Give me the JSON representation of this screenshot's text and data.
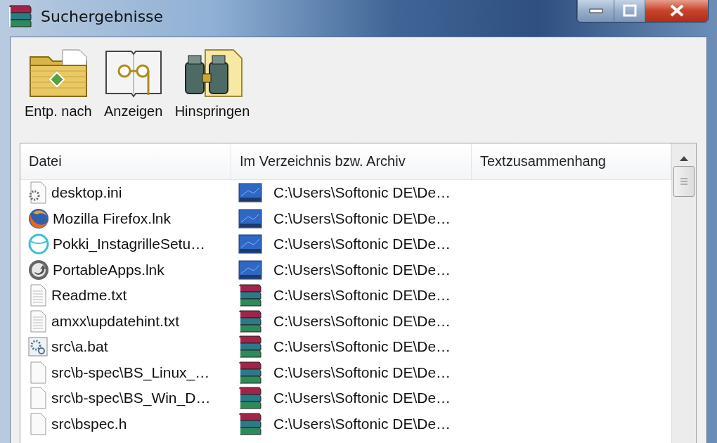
{
  "window": {
    "title": "Suchergebnisse"
  },
  "toolbar": [
    {
      "kind": "extract",
      "label": "Entp. nach"
    },
    {
      "kind": "view",
      "label": "Anzeigen"
    },
    {
      "kind": "jump",
      "label": "Hinspringen"
    }
  ],
  "table": {
    "columns": [
      "Datei",
      "Im Verzeichnis bzw. Archiv",
      "Textzusammenhang"
    ],
    "rows": [
      {
        "file": {
          "kind": "settings",
          "name": "desktop.ini"
        },
        "location": {
          "kind": "desktop",
          "path": "C:\\Users\\Softonic DE\\De…"
        }
      },
      {
        "file": {
          "kind": "firefox",
          "name": "Mozilla Firefox.lnk"
        },
        "location": {
          "kind": "desktop",
          "path": "C:\\Users\\Softonic DE\\De…"
        }
      },
      {
        "file": {
          "kind": "ring",
          "name": "Pokki_InstagrilleSetu…"
        },
        "location": {
          "kind": "desktop",
          "path": "C:\\Users\\Softonic DE\\De…"
        }
      },
      {
        "file": {
          "kind": "disc",
          "name": "PortableApps.lnk"
        },
        "location": {
          "kind": "desktop",
          "path": "C:\\Users\\Softonic DE\\De…"
        }
      },
      {
        "file": {
          "kind": "text",
          "name": "Readme.txt"
        },
        "location": {
          "kind": "archive",
          "path": "C:\\Users\\Softonic DE\\De…"
        }
      },
      {
        "file": {
          "kind": "text",
          "name": "amxx\\updatehint.txt"
        },
        "location": {
          "kind": "archive",
          "path": "C:\\Users\\Softonic DE\\De…"
        }
      },
      {
        "file": {
          "kind": "batch",
          "name": "src\\a.bat"
        },
        "location": {
          "kind": "archive",
          "path": "C:\\Users\\Softonic DE\\De…"
        }
      },
      {
        "file": {
          "kind": "blank",
          "name": "src\\b-spec\\BS_Linux_…"
        },
        "location": {
          "kind": "archive",
          "path": "C:\\Users\\Softonic DE\\De…"
        }
      },
      {
        "file": {
          "kind": "blank",
          "name": "src\\b-spec\\BS_Win_D…"
        },
        "location": {
          "kind": "archive",
          "path": "C:\\Users\\Softonic DE\\De…"
        }
      },
      {
        "file": {
          "kind": "blank",
          "name": "src\\bspec.h"
        },
        "location": {
          "kind": "archive",
          "path": "C:\\Users\\Softonic DE\\De…"
        }
      }
    ]
  }
}
